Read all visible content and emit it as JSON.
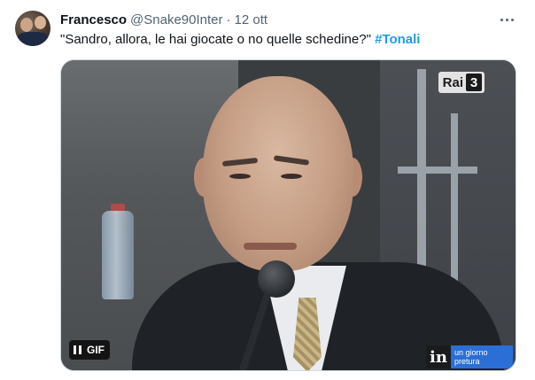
{
  "author": {
    "name": "Francesco",
    "handle": "@Snake90Inter",
    "separator": "·",
    "time": "12 ott"
  },
  "tweet": {
    "text": "\"Sandro, allora, le hai giocate o no quelle schedine?\"",
    "hashtag": "#Tonali"
  },
  "media": {
    "gif_label": "GIF",
    "channel_logo": {
      "prefix": "Rai",
      "number": "3"
    },
    "show_logo": {
      "mark": "in",
      "line1": "un giorno",
      "line2": "pretura"
    }
  },
  "icons": [
    "more-options-icon",
    "pause-icon"
  ],
  "colors": {
    "hashtag": "#1d9bf0",
    "secondary_text": "#536471",
    "show_logo_blue": "#2b6fd6"
  }
}
